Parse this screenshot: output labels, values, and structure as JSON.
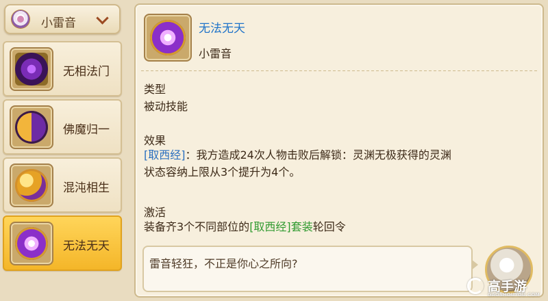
{
  "dropdown": {
    "label": "小雷音",
    "emblem_icon": "sect-emblem-icon",
    "chevron_icon": "chevron-down-icon"
  },
  "skills": [
    {
      "name": "无相法门",
      "icon": "wuxiang-fame-icon",
      "active": false
    },
    {
      "name": "佛魔归一",
      "icon": "fomo-guiyi-icon",
      "active": false
    },
    {
      "name": "混沌相生",
      "icon": "hundun-xiangsheng-icon",
      "active": false
    },
    {
      "name": "无法无天",
      "icon": "wufa-wutian-icon",
      "active": true
    }
  ],
  "detail": {
    "title": "无法无天",
    "sect": "小雷音",
    "type_label": "类型",
    "type_value": "被动技能",
    "effect_label": "效果",
    "effect_tag": "[取西经]",
    "effect_text_line1": "：我方造成24次人物击败后解锁：灵渊无极获得的灵渊",
    "effect_text_line2": "状态容纳上限从3个提升为4个。",
    "activate_label": "激活",
    "activate_prefix": "装备齐3个不同部位的",
    "activate_tag": "[取西经]",
    "activate_mid": "套装",
    "activate_suffix": "轮回令",
    "quote": "雷音轻狂，不正是你心之所向?"
  },
  "watermark": {
    "text": "高手游",
    "url": "GAOSHOUYOU.COM"
  },
  "colors": {
    "title_blue": "#1f73c9",
    "tag_blue": "#2a6fbf",
    "tag_green": "#2f9a2f",
    "active_item": "#f4b629"
  }
}
